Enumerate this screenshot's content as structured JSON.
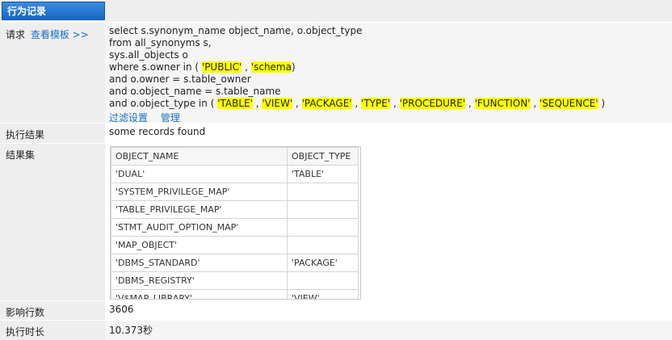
{
  "header": {
    "tab_title": "行为记录"
  },
  "request": {
    "label": "请求",
    "template_link": "查看模板 >>",
    "sql_lines": [
      [
        {
          "t": "select s.synonym_name object_name, o.object_type"
        }
      ],
      [
        {
          "t": "from all_synonyms s,"
        }
      ],
      [
        {
          "t": "sys.all_objects o"
        }
      ],
      [
        {
          "t": "where s.owner in ( "
        },
        {
          "t": "'PUBLIC'",
          "hl": true
        },
        {
          "t": " , "
        },
        {
          "t": "'schema",
          "hl": true
        },
        {
          "t": ")"
        }
      ],
      [
        {
          "t": "and o.owner = s.table_owner"
        }
      ],
      [
        {
          "t": "and o.object_name = s.table_name"
        }
      ],
      [
        {
          "t": "and o.object_type in ( "
        },
        {
          "t": "'TABLE'",
          "hl": true
        },
        {
          "t": " , "
        },
        {
          "t": "'VIEW'",
          "hl": true
        },
        {
          "t": " , "
        },
        {
          "t": "'PACKAGE'",
          "hl": true
        },
        {
          "t": " , "
        },
        {
          "t": "'TYPE'",
          "hl": true
        },
        {
          "t": " , "
        },
        {
          "t": "'PROCEDURE'",
          "hl": true
        },
        {
          "t": " , "
        },
        {
          "t": "'FUNCTION'",
          "hl": true
        },
        {
          "t": " , "
        },
        {
          "t": "'SEQUENCE'",
          "hl": true
        },
        {
          "t": " )"
        }
      ]
    ],
    "filter_link": "过滤设置",
    "manage_link": "管理",
    "highlight_color": "#ffff00",
    "link_color": "#1a6fc9"
  },
  "exec_result": {
    "label": "执行结果",
    "value": "some records found"
  },
  "result_set": {
    "label": "结果集",
    "columns": [
      "OBJECT_NAME",
      "OBJECT_TYPE"
    ],
    "rows": [
      [
        "'DUAL'",
        "'TABLE'"
      ],
      [
        "'SYSTEM_PRIVILEGE_MAP'",
        ""
      ],
      [
        "'TABLE_PRIVILEGE_MAP'",
        ""
      ],
      [
        "'STMT_AUDIT_OPTION_MAP'",
        ""
      ],
      [
        "'MAP_OBJECT'",
        ""
      ],
      [
        "'DBMS_STANDARD'",
        "'PACKAGE'"
      ],
      [
        "'DBMS_REGISTRY'",
        ""
      ],
      [
        "'V$MAP_LIBRARY'",
        "'VIEW'"
      ]
    ]
  },
  "affected_rows": {
    "label": "影响行数",
    "value": "3606"
  },
  "exec_time": {
    "label": "执行时长",
    "value": "10.373秒"
  }
}
